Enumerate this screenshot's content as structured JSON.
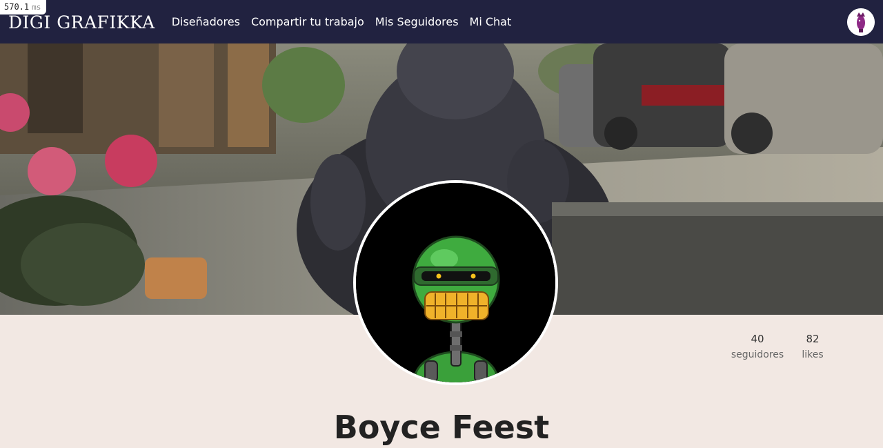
{
  "perf": {
    "value": "570.1",
    "unit": "ms"
  },
  "navbar": {
    "brand": "DIGI GRAFIKKA",
    "links": [
      {
        "label": "Diseñadores"
      },
      {
        "label": "Compartir tu trabajo"
      },
      {
        "label": "Mis Seguidores"
      },
      {
        "label": "Mi Chat"
      }
    ],
    "avatar_icon": "user-avatar-icon"
  },
  "profile": {
    "name": "Boyce Feest",
    "avatar_icon": "robot-avatar-icon",
    "stats": [
      {
        "value": "40",
        "label": "seguidores"
      },
      {
        "value": "82",
        "label": "likes"
      }
    ]
  },
  "colors": {
    "navbar_bg": "#212240",
    "page_bg": "#f2e8e3",
    "text_dark": "#222222"
  }
}
